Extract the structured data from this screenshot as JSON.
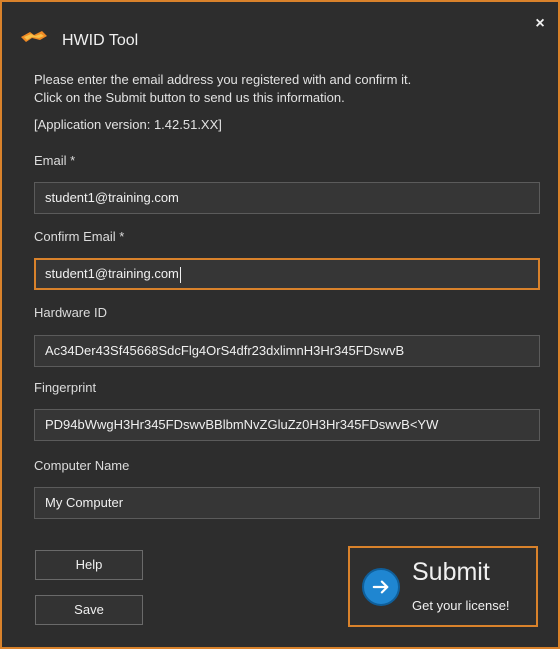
{
  "window": {
    "title": "HWID Tool",
    "close_symbol": "×"
  },
  "intro": {
    "line1": "Please enter the email address you registered with and confirm it.",
    "line2": "Click on the Submit button to send us this information.",
    "version_line": "[Application version: 1.42.51.XX]"
  },
  "fields": {
    "email": {
      "label": "Email *",
      "value": "student1@training.com"
    },
    "confirm_email": {
      "label": "Confirm Email *",
      "value": "student1@training.com"
    },
    "hardware_id": {
      "label": "Hardware ID",
      "value": "Ac34Der43Sf45668SdcFlg4OrS4dfr23dxlimnH3Hr345FDswvB"
    },
    "fingerprint": {
      "label": "Fingerprint",
      "value": "PD94bWwgH3Hr345FDswvBBlbmNvZGluZz0H3Hr345FDswvB<YW"
    },
    "computer_name": {
      "label": "Computer Name",
      "value": "My Computer"
    }
  },
  "buttons": {
    "help": "Help",
    "save": "Save",
    "submit_title": "Submit",
    "submit_subtitle": "Get your license!"
  },
  "colors": {
    "accent": "#d9822b",
    "background": "#2d2d2d",
    "submit_icon": "#1f86d1"
  },
  "icons": {
    "app_logo": "hwid-tool-logo-icon",
    "close": "close-icon",
    "submit": "arrow-right-circle-icon"
  }
}
